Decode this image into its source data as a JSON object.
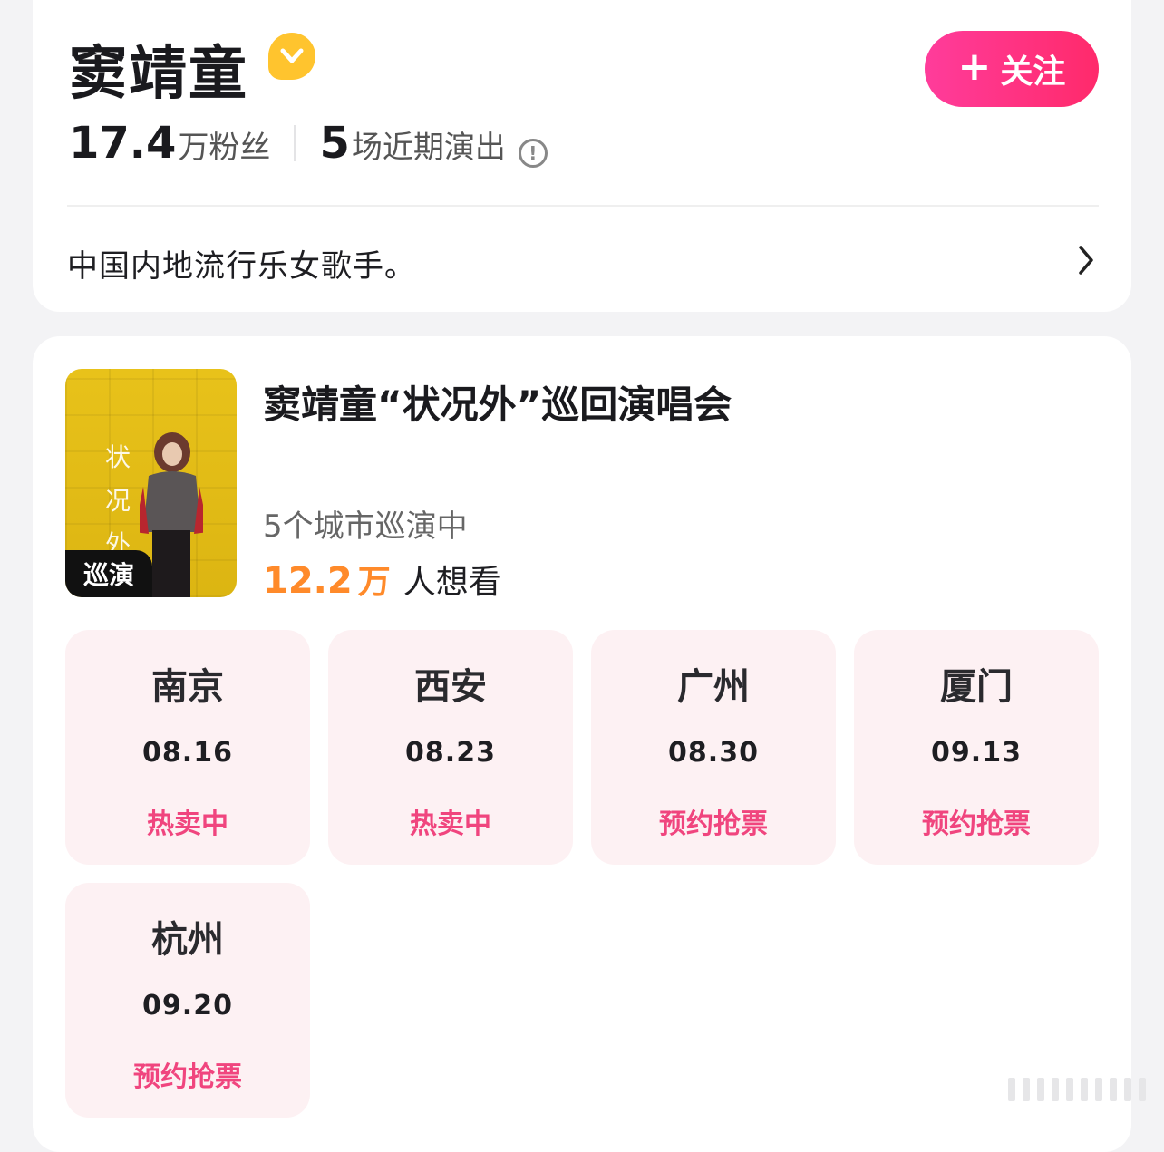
{
  "artist": {
    "name": "窦靖童",
    "follow_label": "关注",
    "fans_num": "17.4",
    "fans_unit": "万粉丝",
    "shows_num": "5",
    "shows_unit": "场近期演出",
    "bio": "中国内地流行乐女歌手。"
  },
  "tour": {
    "title": "窦靖童“状况外”巡回演唱会",
    "poster_badge": "巡演",
    "poster_text": "状况外",
    "cities_text": "5个城市巡演中",
    "want_num": "12.2",
    "want_unit": "万",
    "want_text": "人想看",
    "shows": [
      {
        "city": "南京",
        "date": "08.16",
        "status": "热卖中"
      },
      {
        "city": "西安",
        "date": "08.23",
        "status": "热卖中"
      },
      {
        "city": "广州",
        "date": "08.30",
        "status": "预约抢票"
      },
      {
        "city": "厦门",
        "date": "09.13",
        "status": "预约抢票"
      },
      {
        "city": "杭州",
        "date": "09.20",
        "status": "预约抢票"
      }
    ]
  },
  "colors": {
    "accent_pink": "#ff3c9b",
    "status_pink": "#f0457e",
    "want_orange": "#ff8a2a",
    "verified_yellow": "#ffc42e",
    "show_card_bg": "#fdf1f3"
  },
  "icons": [
    "verified-icon",
    "plus-icon",
    "info-icon",
    "chevron-right-icon"
  ]
}
